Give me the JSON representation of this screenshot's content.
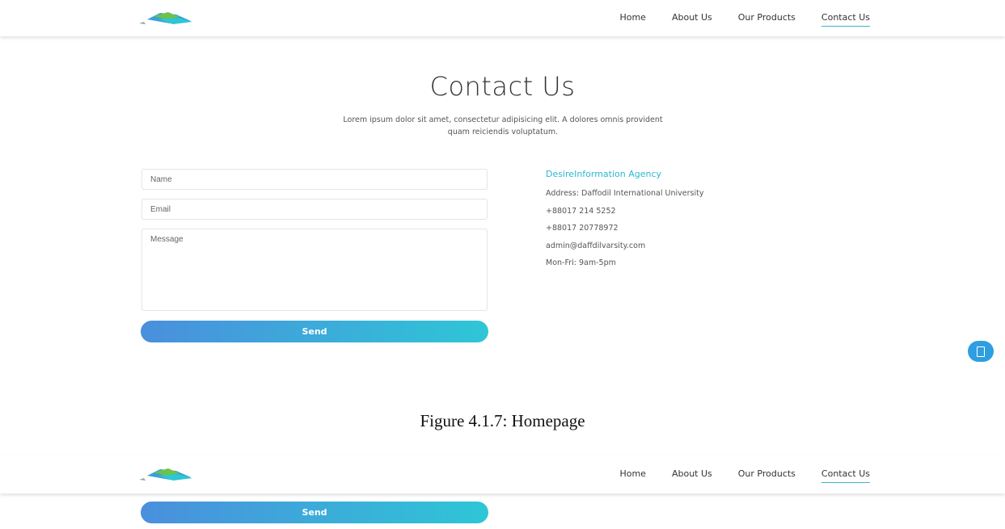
{
  "nav": {
    "links": [
      "Home",
      "About Us",
      "Our Products",
      "Contact Us"
    ],
    "active": "Contact Us"
  },
  "page": {
    "title": "Contact Us",
    "subtitle": "Lorem ipsum dolor sit amet, consectetur adipisicing elit. A dolores omnis provident quam reiciendis voluptatum."
  },
  "form": {
    "name_placeholder": "Name",
    "email_placeholder": "Email",
    "message_placeholder": "Message",
    "send_label": "Send"
  },
  "contact": {
    "agency": "DesireInformation Agency",
    "address": "Address: Daffodil International University",
    "phone1": "+88017 214 5252",
    "phone2": "+88017 20778972",
    "email": "admin@daffdilvarsity.com",
    "hours": "Mon-Fri: 9am-5pm"
  },
  "caption": "Figure 4.1.7: Homepage",
  "colors": {
    "accent": "#2bb8cf",
    "button_start": "#4a8fdd",
    "button_end": "#2ec6d6",
    "fab": "#2f9ee0"
  },
  "icons": {
    "logo": "brand-logo",
    "fab": "chat-icon"
  }
}
